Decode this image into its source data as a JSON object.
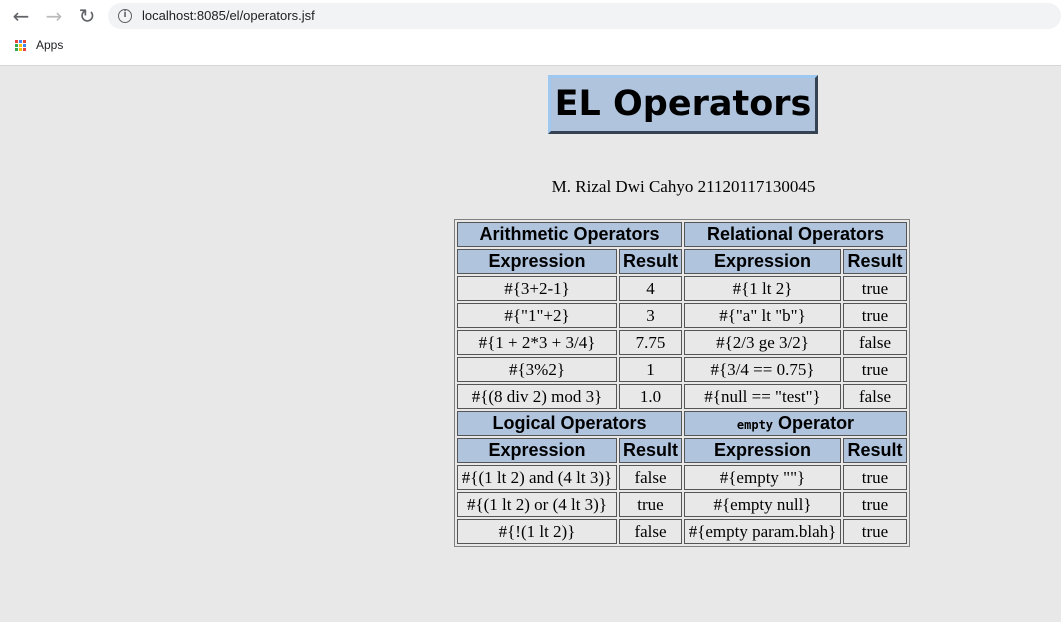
{
  "browser": {
    "url": "localhost:8085/el/operators.jsf",
    "bookmark": "Apps"
  },
  "page": {
    "title": "EL Operators",
    "author": "M. Rizal Dwi Cahyo 21120117130045"
  },
  "table": {
    "expr_header": "Expression",
    "result_header": "Result",
    "sections": [
      {
        "left_title": "Arithmetic Operators",
        "right_title_code": "",
        "right_title": "Relational Operators",
        "rows": [
          [
            "#{3+2-1}",
            "4",
            "#{1 lt 2}",
            "true"
          ],
          [
            "#{\"1\"+2}",
            "3",
            "#{\"a\" lt \"b\"}",
            "true"
          ],
          [
            "#{1 + 2*3 + 3/4}",
            "7.75",
            "#{2/3 ge 3/2}",
            "false"
          ],
          [
            "#{3%2}",
            "1",
            "#{3/4 == 0.75}",
            "true"
          ],
          [
            "#{(8 div 2) mod 3}",
            "1.0",
            "#{null == \"test\"}",
            "false"
          ]
        ]
      },
      {
        "left_title": "Logical Operators",
        "right_title_code": "empty",
        "right_title": "Operator",
        "rows": [
          [
            "#{(1 lt 2) and (4 lt 3)}",
            "false",
            "#{empty \"\"}",
            "true"
          ],
          [
            "#{(1 lt 2) or (4 lt 3)}",
            "true",
            "#{empty null}",
            "true"
          ],
          [
            "#{!(1 lt 2)}",
            "false",
            "#{empty param.blah}",
            "true"
          ]
        ]
      }
    ]
  }
}
